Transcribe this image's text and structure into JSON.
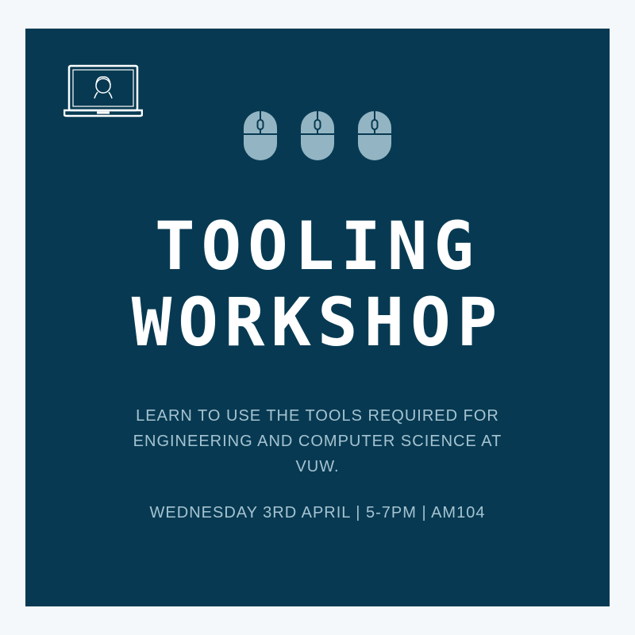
{
  "poster": {
    "title_line1": "TOOLING",
    "title_line2": "WORKSHOP",
    "description": "LEARN TO USE THE TOOLS REQUIRED FOR ENGINEERING AND COMPUTER SCIENCE AT VUW.",
    "details": "WEDNESDAY 3RD APRIL | 5-7PM | AM104"
  },
  "colors": {
    "background": "#073a52",
    "page": "#f4f8fb",
    "title": "#ffffff",
    "body_text": "#a6c3d1",
    "mouse_fill": "#93b5c3"
  },
  "icons": [
    "laptop-user-icon",
    "computer-mouse-icon"
  ]
}
